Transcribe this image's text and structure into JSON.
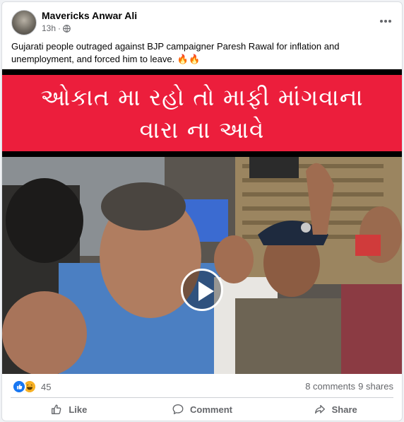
{
  "post": {
    "author": "Mavericks Anwar Ali",
    "time": "13h",
    "caption": "Gujarati people outraged against BJP campaigner Paresh Rawal for inflation and unemployment, and forced him to leave. 🔥🔥"
  },
  "video": {
    "banner_line1": "ઓકાત મા રહો તો માફી માંગવાના",
    "banner_line2": "વારા ના આવે",
    "banner_color": "#ec1e3c"
  },
  "stats": {
    "reaction_count": "45",
    "comments": "8 comments",
    "shares": "9 shares"
  },
  "actions": {
    "like": "Like",
    "comment": "Comment",
    "share": "Share"
  },
  "icons": [
    "globe-icon",
    "more-icon",
    "play-icon",
    "like-reaction-icon",
    "haha-reaction-icon",
    "thumbs-up-icon",
    "comment-icon",
    "share-icon"
  ]
}
